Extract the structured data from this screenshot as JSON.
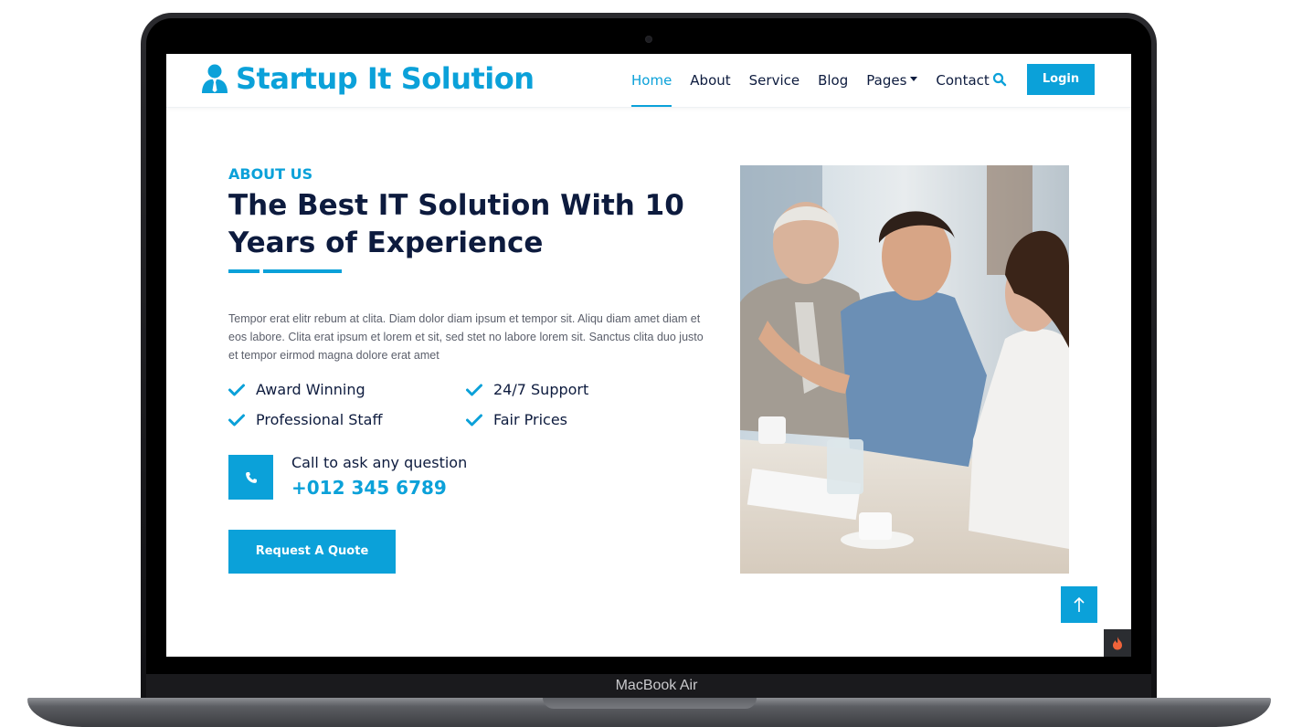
{
  "device": {
    "label": "MacBook Air"
  },
  "brand": {
    "name": "Startup It Solution",
    "icon": "user-tie-icon"
  },
  "nav": {
    "items": [
      {
        "label": "Home",
        "active": true
      },
      {
        "label": "About",
        "active": false
      },
      {
        "label": "Service",
        "active": false
      },
      {
        "label": "Blog",
        "active": false
      },
      {
        "label": "Pages",
        "active": false,
        "dropdown": true
      },
      {
        "label": "Contact",
        "active": false
      }
    ],
    "search_icon": "search-icon",
    "login_label": "Login"
  },
  "about": {
    "eyebrow": "ABOUT US",
    "heading": "The Best IT Solution With 10 Years of Experience",
    "paragraph": "Tempor erat elitr rebum at clita. Diam dolor diam ipsum et tempor sit. Aliqu diam amet diam et eos labore. Clita erat ipsum et lorem et sit, sed stet no labore lorem sit. Sanctus clita duo justo et tempor eirmod magna dolore erat amet",
    "features": [
      "Award Winning",
      "24/7 Support",
      "Professional Staff",
      "Fair Prices"
    ],
    "call_label": "Call to ask any question",
    "call_number": "+012 345 6789",
    "quote_button": "Request A Quote"
  },
  "colors": {
    "accent": "#0ba1d9",
    "heading": "#0d1b3e",
    "body_text": "#5b5f6b"
  }
}
